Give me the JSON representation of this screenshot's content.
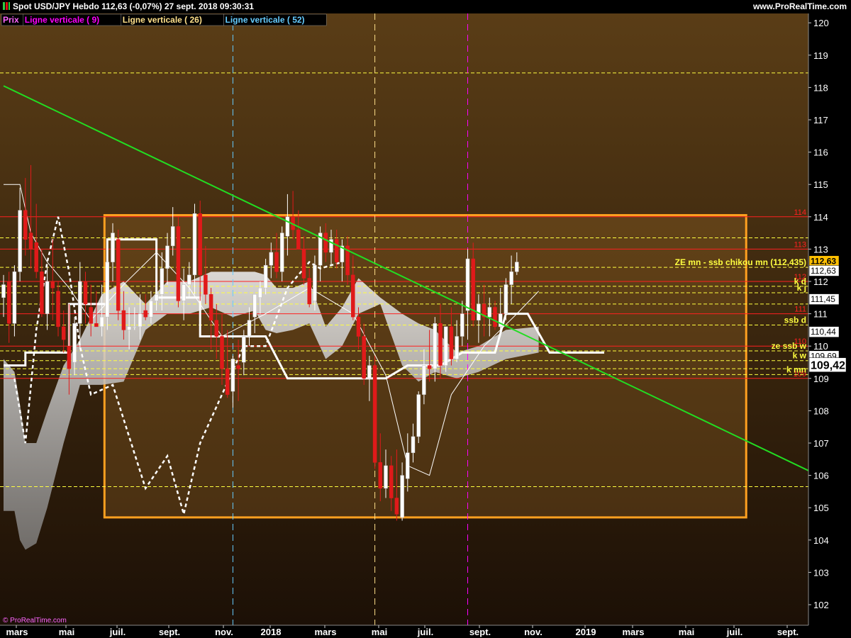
{
  "header": {
    "title": "Spot USD/JPY   Hebdo   112,63 (-0,07%)   27 sept. 2018 09:30:31",
    "site": "www.ProRealTime.com"
  },
  "legend": [
    {
      "label": "Prix",
      "color": "#ff66ff"
    },
    {
      "label": "Ligne verticale ( 9)",
      "color": "#ff00ff"
    },
    {
      "label": "Ligne verticale ( 26)",
      "color": "#ffe08a"
    },
    {
      "label": "Ligne verticale ( 52)",
      "color": "#66ccff"
    }
  ],
  "watermark": "© ProRealTime.com",
  "colors": {
    "background_top": "#5a3d16",
    "background_bottom": "#1c1006",
    "candle_up": "#ffffff",
    "candle_down": "#e01a1a",
    "trendline": "#22dd22",
    "zone_border": "#ffa020",
    "level_red": "#ff2020",
    "level_yellow": "#ffff40"
  },
  "chart_data": {
    "type": "candlestick",
    "timeframe": "Hebdo",
    "ylim": [
      101.5,
      120.3
    ],
    "y_ticks": [
      "102",
      "103",
      "104",
      "105",
      "106",
      "107",
      "108",
      "109",
      "110",
      "111",
      "112",
      "113",
      "114",
      "115",
      "116",
      "117",
      "118",
      "119",
      "120"
    ],
    "x_ticks": [
      "mars",
      "mai",
      "juil.",
      "sept.",
      "nov.",
      "2018",
      "mars",
      "mai",
      "juil.",
      "sept.",
      "nov.",
      "2019",
      "mars",
      "mai",
      "juil.",
      "sept."
    ],
    "last_price": "112,63",
    "price_labels": [
      {
        "text": "112,63",
        "value": 112.63,
        "style": "last"
      },
      {
        "text": "112,63",
        "value": 112.33,
        "style": "white"
      },
      {
        "text": "111,45",
        "value": 111.45,
        "style": "white"
      },
      {
        "text": "110,44",
        "value": 110.44,
        "style": "white"
      },
      {
        "text": "109,69",
        "value": 109.69,
        "style": "white"
      },
      {
        "text": "109,42",
        "value": 109.42,
        "style": "big"
      }
    ],
    "horizontal_levels": [
      {
        "value": 114.0,
        "label": "114",
        "color": "#ff2020",
        "style": "solid"
      },
      {
        "value": 113.0,
        "label": "113",
        "color": "#ff2020",
        "style": "solid"
      },
      {
        "value": 112.0,
        "label": "112",
        "color": "#ff2020",
        "style": "solid"
      },
      {
        "value": 111.0,
        "label": "111",
        "color": "#ff2020",
        "style": "solid"
      },
      {
        "value": 110.0,
        "label": "110",
        "color": "#ff2020",
        "style": "solid"
      },
      {
        "value": 109.0,
        "label": "109",
        "color": "#ff2020",
        "style": "solid"
      },
      {
        "value": 118.45,
        "label": "",
        "color": "#ffff40",
        "style": "dash"
      },
      {
        "value": 113.35,
        "label": "",
        "color": "#ffff40",
        "style": "dash"
      },
      {
        "value": 112.435,
        "label": "ZE mn - ssb chikou mn (112,435)",
        "color": "#ffff40",
        "style": "dash"
      },
      {
        "value": 111.85,
        "label": "k d",
        "color": "#ffff40",
        "style": "dash"
      },
      {
        "value": 111.65,
        "label": "k j",
        "color": "#ffff40",
        "style": "dash"
      },
      {
        "value": 111.3,
        "label": "",
        "color": "#ffff40",
        "style": "dash"
      },
      {
        "value": 110.65,
        "label": "ssb d",
        "color": "#ffff40",
        "style": "dash"
      },
      {
        "value": 109.85,
        "label": "ze ssb w",
        "color": "#ffff40",
        "style": "dash"
      },
      {
        "value": 109.55,
        "label": "k w",
        "color": "#ffff40",
        "style": "dash"
      },
      {
        "value": 109.3,
        "label": "",
        "color": "#ffff40",
        "style": "dash"
      },
      {
        "value": 109.12,
        "label": "k mn",
        "color": "#ffff40",
        "style": "dash"
      },
      {
        "value": 105.65,
        "label": "",
        "color": "#ffff40",
        "style": "dash"
      }
    ],
    "vertical_lines": [
      {
        "name": "Ligne verticale ( 52)",
        "x_index": 42,
        "color": "#66ccff"
      },
      {
        "name": "Ligne verticale ( 26)",
        "x_index": 68,
        "color": "#ffe08a"
      },
      {
        "name": "Ligne verticale ( 9)",
        "x_index": 85,
        "color": "#ff00ff"
      }
    ],
    "zone": {
      "from_index": 19,
      "to_index": 136,
      "high": 114.05,
      "low": 104.7
    },
    "trendline": {
      "from": {
        "x_index": 0,
        "y": 118.05
      },
      "to": {
        "x_index": 148,
        "y": 106.1
      }
    },
    "candles": [
      [
        111.5,
        112.2,
        110.9,
        111.9
      ],
      [
        112.0,
        112.3,
        110.1,
        110.7
      ],
      [
        110.7,
        112.5,
        110.3,
        112.3
      ],
      [
        112.3,
        114.9,
        112.0,
        114.2
      ],
      [
        114.2,
        115.2,
        112.8,
        113.3
      ],
      [
        113.5,
        115.6,
        112.4,
        113.0
      ],
      [
        113.2,
        114.4,
        112.1,
        112.3
      ],
      [
        112.3,
        113.0,
        110.9,
        111.0
      ],
      [
        111.0,
        112.5,
        110.5,
        112.0
      ],
      [
        112.0,
        113.3,
        110.8,
        111.8
      ],
      [
        111.7,
        112.0,
        110.3,
        110.6
      ],
      [
        110.6,
        111.1,
        109.8,
        110.2
      ],
      [
        110.0,
        111.3,
        108.5,
        109.3
      ],
      [
        109.5,
        110.9,
        109.1,
        110.7
      ],
      [
        110.7,
        112.6,
        109.9,
        112.0
      ],
      [
        112.0,
        112.3,
        110.7,
        111.3
      ],
      [
        111.2,
        111.9,
        110.3,
        110.7
      ],
      [
        110.7,
        111.7,
        110.6,
        110.6
      ],
      [
        110.6,
        111.9,
        110.3,
        110.9
      ],
      [
        110.9,
        112.8,
        110.5,
        112.6
      ],
      [
        112.6,
        113.8,
        112.0,
        113.5
      ],
      [
        113.3,
        113.6,
        110.8,
        111.1
      ],
      [
        111.1,
        111.7,
        110.2,
        110.5
      ],
      [
        110.5,
        111.2,
        109.9,
        110.6
      ],
      [
        110.6,
        111.2,
        110.5,
        110.6
      ],
      [
        110.6,
        111.6,
        110.2,
        111.0
      ],
      [
        111.1,
        111.6,
        110.8,
        110.9
      ],
      [
        110.9,
        111.7,
        110.7,
        111.4
      ],
      [
        111.4,
        112.0,
        111.1,
        111.6
      ],
      [
        111.6,
        112.9,
        111.1,
        112.4
      ],
      [
        112.4,
        113.5,
        111.9,
        113.1
      ],
      [
        113.1,
        114.3,
        112.8,
        113.7
      ],
      [
        113.7,
        114.0,
        111.2,
        111.4
      ],
      [
        111.4,
        112.4,
        110.8,
        111.9
      ],
      [
        111.9,
        112.6,
        111.5,
        112.2
      ],
      [
        112.2,
        114.4,
        111.6,
        114.1
      ],
      [
        114.1,
        114.5,
        111.4,
        112.2
      ],
      [
        112.2,
        113.1,
        111.3,
        111.6
      ],
      [
        111.6,
        111.8,
        109.9,
        110.8
      ],
      [
        110.8,
        111.3,
        109.6,
        110.3
      ],
      [
        110.3,
        111.0,
        108.8,
        109.3
      ],
      [
        109.3,
        110.5,
        108.4,
        108.5
      ],
      [
        108.6,
        109.7,
        108.1,
        109.6
      ],
      [
        109.4,
        110.2,
        108.3,
        109.3
      ],
      [
        109.5,
        110.5,
        109.1,
        110.3
      ],
      [
        110.3,
        111.2,
        110.0,
        110.8
      ],
      [
        110.9,
        111.6,
        110.4,
        111.6
      ],
      [
        111.5,
        112.0,
        111.0,
        111.8
      ],
      [
        111.8,
        112.7,
        111.6,
        112.5
      ],
      [
        112.5,
        113.2,
        112.1,
        112.9
      ],
      [
        112.9,
        113.5,
        112.1,
        112.3
      ],
      [
        112.3,
        113.7,
        112.0,
        113.5
      ],
      [
        113.4,
        114.7,
        112.8,
        114.0
      ],
      [
        114.0,
        114.8,
        113.3,
        113.6
      ],
      [
        113.6,
        114.2,
        113.0,
        113.0
      ],
      [
        113.0,
        113.4,
        111.9,
        112.1
      ],
      [
        112.1,
        112.4,
        111.2,
        111.3
      ],
      [
        111.4,
        112.8,
        111.1,
        112.5
      ],
      [
        112.5,
        113.7,
        112.0,
        113.5
      ],
      [
        113.5,
        113.8,
        112.6,
        112.9
      ],
      [
        112.9,
        113.6,
        112.5,
        113.3
      ],
      [
        113.3,
        113.6,
        112.4,
        112.6
      ],
      [
        112.6,
        113.3,
        112.0,
        113.1
      ],
      [
        113.1,
        113.4,
        111.9,
        112.2
      ],
      [
        112.2,
        112.8,
        110.8,
        110.9
      ],
      [
        110.9,
        111.2,
        109.9,
        110.3
      ],
      [
        110.3,
        110.7,
        108.8,
        109.0
      ],
      [
        109.0,
        109.7,
        108.3,
        109.4
      ],
      [
        109.4,
        109.7,
        106.2,
        106.4
      ],
      [
        106.4,
        107.3,
        105.2,
        105.6
      ],
      [
        105.6,
        106.8,
        105.3,
        106.3
      ],
      [
        106.3,
        106.6,
        104.9,
        105.3
      ],
      [
        105.3,
        106.8,
        104.6,
        104.8
      ],
      [
        104.7,
        106.4,
        104.6,
        106.0
      ],
      [
        105.9,
        107.3,
        105.5,
        106.7
      ],
      [
        106.7,
        107.6,
        106.4,
        107.2
      ],
      [
        107.2,
        108.6,
        107.0,
        108.5
      ],
      [
        108.5,
        109.9,
        108.2,
        109.4
      ],
      [
        109.4,
        110.5,
        108.9,
        109.3
      ],
      [
        109.3,
        110.9,
        108.9,
        110.7
      ],
      [
        110.7,
        111.3,
        109.0,
        109.4
      ],
      [
        109.4,
        110.6,
        109.2,
        110.6
      ],
      [
        110.6,
        111.2,
        109.4,
        109.6
      ],
      [
        109.6,
        110.8,
        109.5,
        110.3
      ],
      [
        110.3,
        111.4,
        110.0,
        111.0
      ],
      [
        111.1,
        113.0,
        110.2,
        112.7
      ],
      [
        112.7,
        113.2,
        110.6,
        110.8
      ],
      [
        110.8,
        111.6,
        110.1,
        111.3
      ],
      [
        111.3,
        111.9,
        110.3,
        110.9
      ],
      [
        110.9,
        111.5,
        110.3,
        111.2
      ],
      [
        111.2,
        111.4,
        110.5,
        110.6
      ],
      [
        110.6,
        111.8,
        110.3,
        111.0
      ],
      [
        111.0,
        112.1,
        110.8,
        111.9
      ],
      [
        111.9,
        112.8,
        111.3,
        112.3
      ],
      [
        112.3,
        112.9,
        112.2,
        112.6
      ]
    ]
  }
}
